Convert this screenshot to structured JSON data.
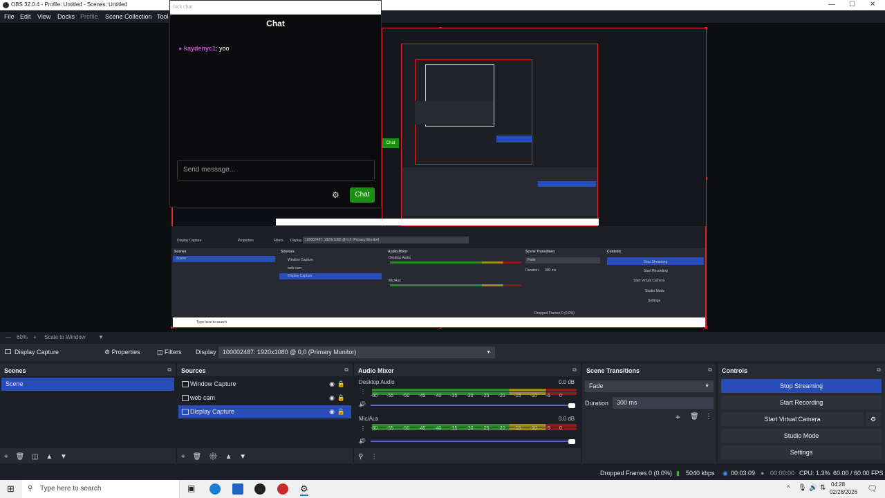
{
  "window": {
    "title": "OBS 32.0.4 - Profile: Untitled - Scenes: Untitled",
    "min": "—",
    "max": "☐",
    "close": "✕"
  },
  "menu": {
    "file": "File",
    "edit": "Edit",
    "view": "View",
    "docks": "Docks",
    "profile": "Profile",
    "scene_collection": "Scene Collection",
    "tools": "Tool"
  },
  "chat": {
    "header": "kick chat",
    "title": "Chat",
    "messages": [
      {
        "user": "kaydenyc1",
        "text": ": yoo"
      }
    ],
    "input_placeholder": "Send message...",
    "send_label": "Chat",
    "settings_icon": "gear-icon"
  },
  "preview_mirror": {
    "display_capture": "Display Capture",
    "properties": "Properties",
    "filters": "Filters",
    "display": "Display",
    "display_value": "100002487: 1920x1080 @ 0,0 (Primary Monitor)",
    "scenes": "Scenes",
    "sources": "Sources",
    "audio_mixer": "Audio Mixer",
    "scene_transitions": "Scene Transitions",
    "controls": "Controls",
    "scene": "Scene",
    "window_capture": "Window Capture",
    "web_cam": "web cam",
    "desktop_audio": "Desktop Audio",
    "mic_aux": "Mic/Aux",
    "fade": "Fade",
    "duration": "Duration",
    "duration_value": "300 ms",
    "stop_streaming": "Stop Streaming",
    "start_recording": "Start Recording",
    "start_virtual_camera": "Start Virtual Camera",
    "studio_mode": "Studio Mode",
    "settings": "Settings",
    "search": "Type here to search",
    "status": "Dropped Frames 0 (0.0%)",
    "chat": "Chat"
  },
  "zoom": {
    "level": "60%",
    "mode": "Scale to Window"
  },
  "source_toolbar": {
    "source_name": "Display Capture",
    "properties": "Properties",
    "filters": "Filters",
    "display_label": "Display",
    "display_value": "100002487: 1920x1080 @ 0,0 (Primary Monitor)"
  },
  "scenes": {
    "title": "Scenes",
    "items": [
      "Scene"
    ]
  },
  "sources": {
    "title": "Sources",
    "items": [
      "Window Capture",
      "web cam",
      "Display Capture"
    ]
  },
  "mixer": {
    "title": "Audio Mixer",
    "channels": [
      {
        "name": "Desktop Audio",
        "db": "0.0 dB",
        "level": 1.0
      },
      {
        "name": "Mic/Aux",
        "db": "0.0 dB",
        "level": 1.0
      }
    ],
    "ticks": "-60 -55 -50 -45 -40 -35 -30 -25 -20 -15 -10 -5 0"
  },
  "transitions": {
    "title": "Scene Transitions",
    "type": "Fade",
    "duration_label": "Duration",
    "duration": "300 ms"
  },
  "controls": {
    "title": "Controls",
    "stop_streaming": "Stop Streaming",
    "start_recording": "Start Recording",
    "start_virtual_camera": "Start Virtual Camera",
    "studio_mode": "Studio Mode",
    "settings": "Settings"
  },
  "status": {
    "dropped": "Dropped Frames 0 (0.0%)",
    "bitrate": "5040 kbps",
    "stream_time": "00:03:09",
    "rec_time": "00:00:00",
    "cpu": "CPU: 1.3%",
    "fps": "60.00 / 60.00 FPS"
  },
  "taskbar": {
    "search": "Type here to search",
    "time": "04:28",
    "date": "02/28/2026"
  },
  "colors": {
    "accent": "#284cb8",
    "selection_red": "#e3252b",
    "chat_button": "#1c8f12",
    "panel": "#272a33",
    "background": "#1d1f26"
  }
}
